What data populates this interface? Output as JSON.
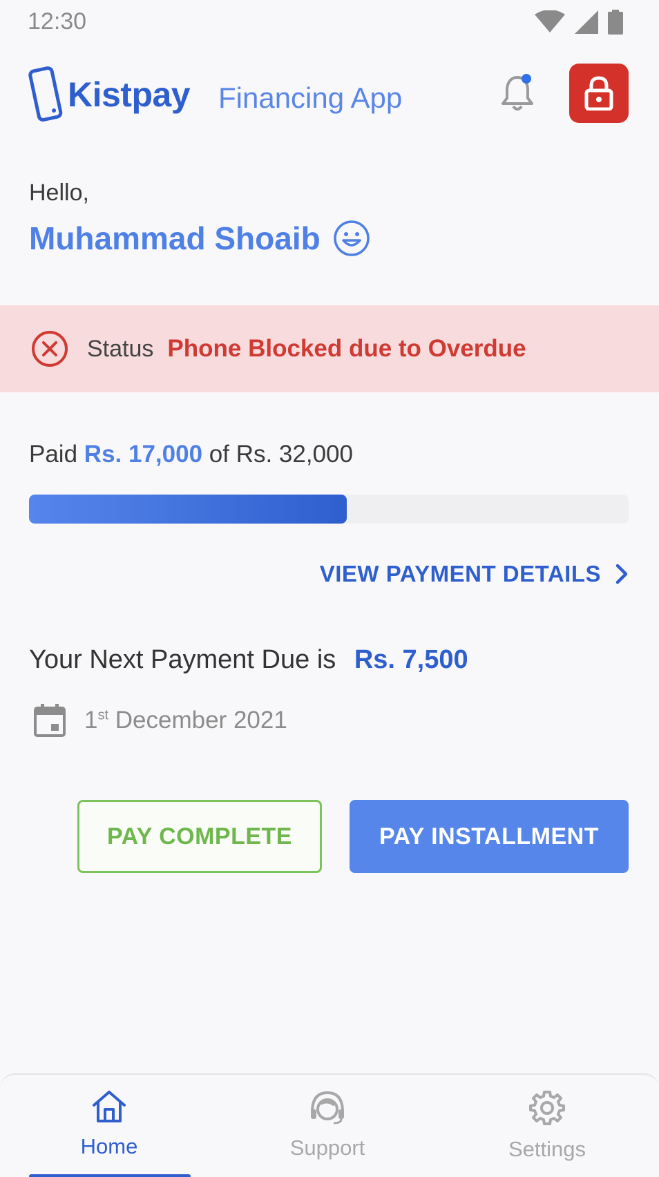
{
  "status_bar": {
    "time": "12:30"
  },
  "header": {
    "brand": "Kistpay",
    "brand_sub": "Financing App",
    "notification_dot_color": "#2f6fe8",
    "lock_button_color": "#d3312a"
  },
  "greeting": {
    "hello": "Hello,",
    "name": "Muhammad Shoaib"
  },
  "status": {
    "label": "Status",
    "value": "Phone Blocked due to Overdue"
  },
  "payment_progress": {
    "paid_prefix": "Paid",
    "paid_amount": "Rs. 17,000",
    "of_text": "of Rs. 32,000",
    "progress_fraction": 0.53
  },
  "view_details_label": "VIEW PAYMENT DETAILS",
  "next_payment": {
    "prefix": "Your Next Payment Due is",
    "amount": "Rs. 7,500",
    "date_day": "1",
    "date_suffix": "st",
    "date_rest": "December 2021"
  },
  "actions": {
    "pay_complete": "PAY COMPLETE",
    "pay_installment": "PAY INSTALLMENT"
  },
  "bottom_nav": {
    "items": [
      {
        "label": "Home",
        "icon": "home-icon",
        "active": true
      },
      {
        "label": "Support",
        "icon": "headset-icon",
        "active": false
      },
      {
        "label": "Settings",
        "icon": "gear-icon",
        "active": false
      }
    ]
  },
  "colors": {
    "accent": "#2f5fce",
    "danger": "#cf3a33",
    "success": "#6fb74d"
  }
}
